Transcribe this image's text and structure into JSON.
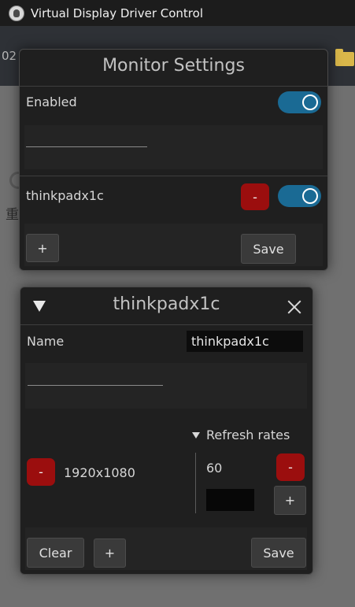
{
  "window": {
    "title": "Virtual Display Driver Control",
    "icon": "app-logo-icon"
  },
  "background": {
    "partial_text": "02",
    "cjk_text": "重"
  },
  "monitor_settings": {
    "title": "Monitor Settings",
    "enabled_label": "Enabled",
    "enabled": true,
    "monitors": [
      {
        "name": "thinkpadx1c",
        "remove_label": "-",
        "enabled": true
      }
    ],
    "add_label": "+",
    "save_label": "Save"
  },
  "monitor_detail": {
    "title": "thinkpadx1c",
    "name_label": "Name",
    "name_value": "thinkpadx1c",
    "resolutions": [
      {
        "remove_label": "-",
        "value": "1920x1080"
      }
    ],
    "refresh_rates_label": "Refresh rates",
    "refresh_rates": [
      {
        "value": "60",
        "remove_label": "-"
      }
    ],
    "new_rate_value": "",
    "add_rate_label": "+",
    "clear_label": "Clear",
    "add_label": "+",
    "save_label": "Save"
  },
  "colors": {
    "toggle_on": "#1a6a94",
    "remove_button": "#9b0e0e",
    "panel_bg": "#1f1f1f"
  }
}
